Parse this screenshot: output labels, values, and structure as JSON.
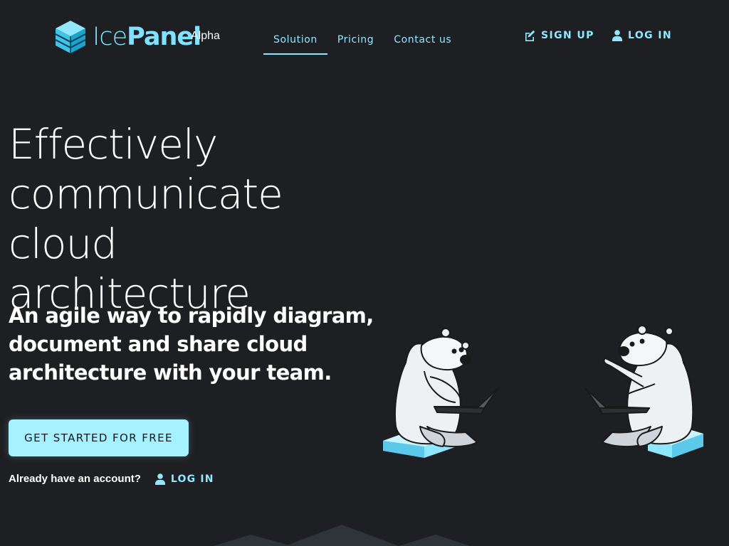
{
  "brand": {
    "name_part1": "Ice",
    "name_part2": "Panel",
    "tag": "Alpha",
    "color": "#7fe3ff"
  },
  "nav": {
    "items": [
      {
        "label": "Solution",
        "active": true
      },
      {
        "label": "Pricing",
        "active": false
      },
      {
        "label": "Contact us",
        "active": false
      }
    ],
    "signup_label": "SIGN UP",
    "signup_icon": "edit-icon",
    "login_label": "LOG IN",
    "login_icon": "user-icon"
  },
  "hero": {
    "headline_lines": [
      "Effectively",
      "communicate cloud",
      "architecture"
    ],
    "subhead_lines": [
      "An agile way to rapidly diagram,",
      "document and share cloud",
      "architecture with your team."
    ],
    "cta_label": "GET STARTED FOR FREE",
    "already_text": "Already have an account?",
    "login_label": "LOG IN",
    "login_icon": "user-icon"
  },
  "illustration": {
    "subject": "two polar bears with laptops sitting on ice blocks"
  },
  "colors": {
    "background": "#1e1f22",
    "accent": "#8fe8ff",
    "cta_bg": "#a6f1ff",
    "text": "#ffffff"
  }
}
